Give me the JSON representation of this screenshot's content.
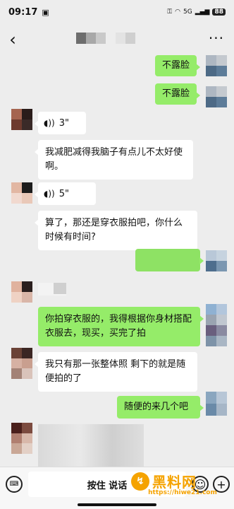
{
  "status_bar": {
    "time": "09:17",
    "network": "5G",
    "battery": "88"
  },
  "nav": {
    "back_icon": "chevron-left-icon",
    "more_icon": "more-dots-icon"
  },
  "messages": [
    {
      "side": "out",
      "type": "text",
      "text": "不露脸"
    },
    {
      "side": "out",
      "type": "text",
      "text": "不露脸"
    },
    {
      "side": "in",
      "type": "voice",
      "duration": "3\""
    },
    {
      "side": "in",
      "type": "text",
      "text": "我减肥减得我脑子有点儿不太好使啊。"
    },
    {
      "side": "in",
      "type": "voice",
      "duration": "5\""
    },
    {
      "side": "in",
      "type": "text",
      "text": "算了，那还是穿衣服拍吧，你什么时候有时间?"
    },
    {
      "side": "out",
      "type": "text",
      "text": ""
    },
    {
      "side": "out",
      "type": "text",
      "text": "你拍穿衣服的，我得根据你身材搭配衣服去，现买，买完了拍"
    },
    {
      "side": "in",
      "type": "text",
      "text": "我只有那一张整体照 剩下的就是随便拍的了"
    },
    {
      "side": "out",
      "type": "text",
      "text": "随便的来几个吧"
    }
  ],
  "input_bar": {
    "hold_to_talk": "按住 说话"
  },
  "watermark": {
    "title": "黑料网",
    "url": "https://hiwe21.com"
  },
  "colors": {
    "background": "#ededed",
    "outgoing_bubble": "#95ec69",
    "incoming_bubble": "#ffffff",
    "watermark": "#f5a300"
  }
}
